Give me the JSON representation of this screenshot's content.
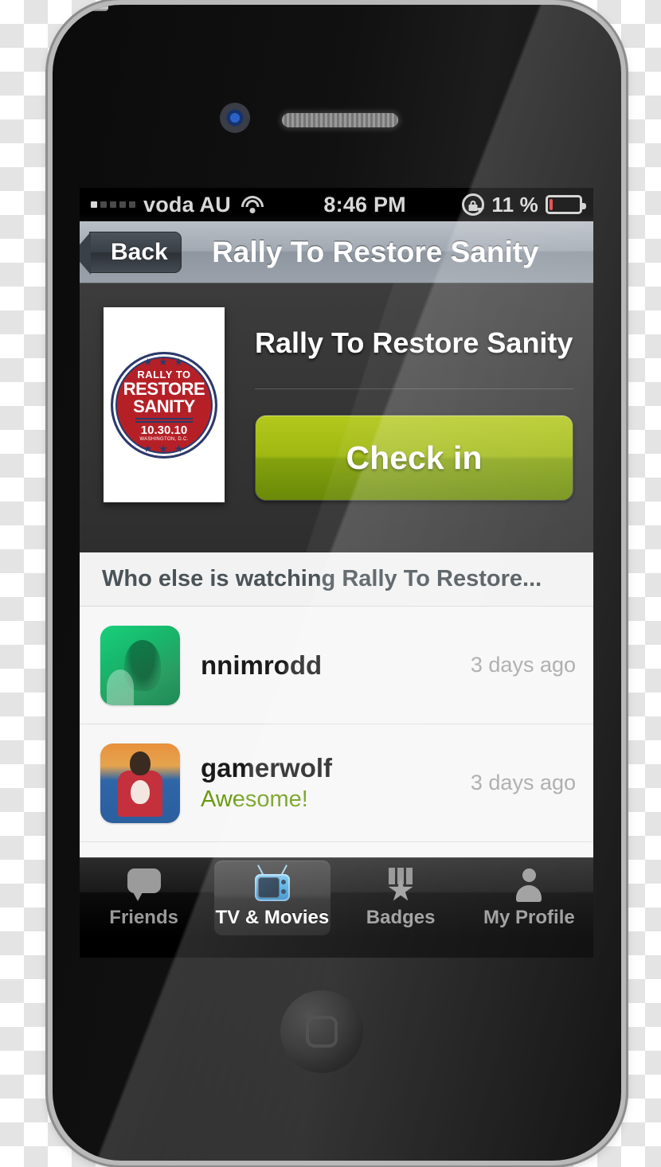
{
  "statusbar": {
    "signal_bars_total": 5,
    "signal_bars_filled": 1,
    "carrier": "voda AU",
    "wifi_icon": "wifi-icon",
    "time": "8:46 PM",
    "rotation_lock_icon": "rotation-lock-icon",
    "battery_percent": "11 %",
    "battery_icon": "battery-icon",
    "battery_level": 11
  },
  "navbar": {
    "back_label": "Back",
    "title": "Rally To Restore Sanity"
  },
  "hero": {
    "poster": {
      "stars_top": "★ ★ ★",
      "line1": "RALLY TO",
      "line2": "RESTORE",
      "line3": "SANITY",
      "date": "10.30.10",
      "location": "WASHINGTON, D.C.",
      "stars_bottom": "★ ★ ★",
      "circle_color": "#b52027",
      "ring_color": "#2b3a6b"
    },
    "show_title": "Rally To Restore Sanity",
    "checkin_label": "Check in",
    "checkin_color": "#9fb812"
  },
  "list": {
    "section_header": "Who else is watching Rally To Restore...",
    "rows": [
      {
        "avatar": "avatar-nnimrodd",
        "username": "nnimrodd",
        "comment": "",
        "timestamp": "3 days ago"
      },
      {
        "avatar": "avatar-gamerwolf",
        "username": "gamerwolf",
        "comment": "Awesome!",
        "timestamp": "3 days ago"
      }
    ],
    "comment_color": "#6a9a10"
  },
  "tabbar": {
    "tabs": [
      {
        "label": "Friends",
        "icon": "speech-bubble-icon",
        "selected": false
      },
      {
        "label": "TV & Movies",
        "icon": "television-icon",
        "selected": true
      },
      {
        "label": "Badges",
        "icon": "medal-icon",
        "selected": false
      },
      {
        "label": "My Profile",
        "icon": "person-icon",
        "selected": false
      }
    ]
  }
}
